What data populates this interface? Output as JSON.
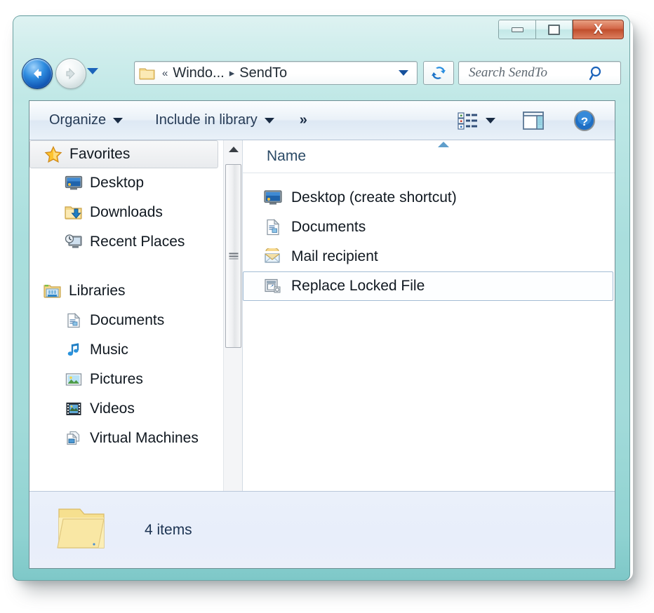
{
  "window": {
    "title": "SendTo",
    "controls": {
      "minimize_label": "Minimize",
      "maximize_label": "Maximize",
      "close_label": "Close",
      "close_glyph": "X"
    },
    "frame_color": "#a9dedd",
    "close_color": "#c04e2d"
  },
  "navigation": {
    "back_label": "Back",
    "forward_label": "Forward",
    "history_label": "Recent pages",
    "refresh_label": "Refresh"
  },
  "address": {
    "overflow_chevron": "«",
    "crumbs": [
      {
        "label": "Windo...",
        "truncated": true
      },
      {
        "label": "SendTo",
        "truncated": false
      }
    ],
    "separator": "▸",
    "dropdown_label": "Previous locations"
  },
  "search": {
    "placeholder": "Search SendTo",
    "value": "",
    "icon": "search-icon"
  },
  "toolbar": {
    "organize_label": "Organize",
    "include_label": "Include in library",
    "overflow_label": "»",
    "views_label": "Change your view",
    "preview_label": "Show the preview pane",
    "help_label": "Get help",
    "help_glyph": "?"
  },
  "sidebar": {
    "groups": [
      {
        "label": "Favorites",
        "icon": "star-icon",
        "focused": true,
        "items": [
          {
            "label": "Desktop",
            "icon": "monitor-icon"
          },
          {
            "label": "Downloads",
            "icon": "downloads-folder-icon"
          },
          {
            "label": "Recent Places",
            "icon": "recent-places-icon"
          }
        ]
      },
      {
        "label": "Libraries",
        "icon": "libraries-icon",
        "focused": false,
        "items": [
          {
            "label": "Documents",
            "icon": "documents-library-icon"
          },
          {
            "label": "Music",
            "icon": "music-note-icon"
          },
          {
            "label": "Pictures",
            "icon": "pictures-icon"
          },
          {
            "label": "Videos",
            "icon": "videos-film-icon"
          },
          {
            "label": "Virtual Machines",
            "icon": "virtual-machines-icon"
          }
        ]
      }
    ]
  },
  "filelist": {
    "columns": [
      {
        "label": "Name",
        "sorted": "ascending"
      }
    ],
    "rows": [
      {
        "name": "Desktop (create shortcut)",
        "icon": "monitor-icon",
        "selected": false
      },
      {
        "name": "Documents",
        "icon": "document-icon",
        "selected": false
      },
      {
        "name": "Mail recipient",
        "icon": "mail-envelope-icon",
        "selected": false
      },
      {
        "name": "Replace Locked File",
        "icon": "shortcut-icon",
        "selected": true
      }
    ]
  },
  "statusbar": {
    "item_count_text": "4 items",
    "folder_icon": "folder-icon"
  }
}
